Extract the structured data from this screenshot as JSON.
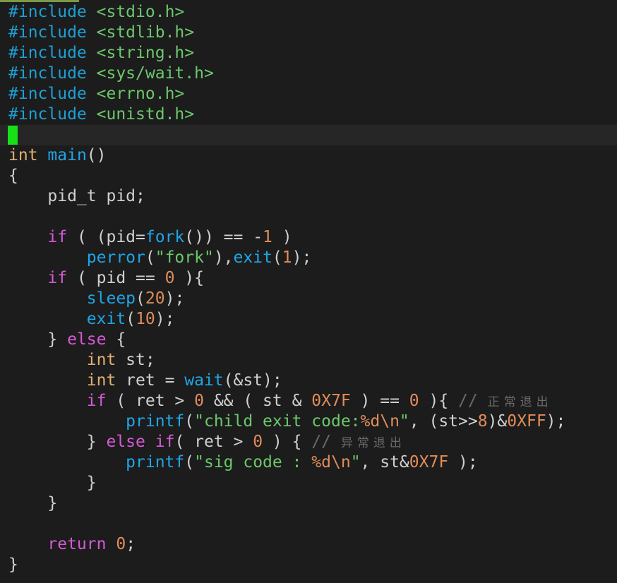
{
  "colors": {
    "background": "#1c1c1c",
    "cursor": "#18e018",
    "preprocessor": "#1e9fd4",
    "header": "#6cc86c",
    "type": "#e0b070",
    "function": "#1ea6e8",
    "keyword": "#d65ad6",
    "number": "#e08c5a",
    "string": "#6cc86c",
    "comment": "#6a6a6a",
    "text": "#d0d0d0"
  },
  "code": {
    "lines": [
      [
        [
          "inc",
          "#include"
        ],
        [
          "plain",
          " "
        ],
        [
          "hdr",
          "<stdio.h>"
        ]
      ],
      [
        [
          "inc",
          "#include"
        ],
        [
          "plain",
          " "
        ],
        [
          "hdr",
          "<stdlib.h>"
        ]
      ],
      [
        [
          "inc",
          "#include"
        ],
        [
          "plain",
          " "
        ],
        [
          "hdr",
          "<string.h>"
        ]
      ],
      [
        [
          "inc",
          "#include"
        ],
        [
          "plain",
          " "
        ],
        [
          "hdr",
          "<sys/wait.h>"
        ]
      ],
      [
        [
          "inc",
          "#include"
        ],
        [
          "plain",
          " "
        ],
        [
          "hdr",
          "<errno.h>"
        ]
      ],
      [
        [
          "inc",
          "#include"
        ],
        [
          "plain",
          " "
        ],
        [
          "hdr",
          "<unistd.h>"
        ]
      ],
      [],
      [
        [
          "type",
          "int"
        ],
        [
          "plain",
          " "
        ],
        [
          "func",
          "main"
        ],
        [
          "plain",
          "()"
        ]
      ],
      [
        [
          "plain",
          "{"
        ]
      ],
      [
        [
          "plain",
          "    pid_t pid;"
        ]
      ],
      [],
      [
        [
          "plain",
          "    "
        ],
        [
          "kw",
          "if"
        ],
        [
          "plain",
          " ( (pid="
        ],
        [
          "func",
          "fork"
        ],
        [
          "plain",
          "()) == -"
        ],
        [
          "num",
          "1"
        ],
        [
          "plain",
          " )"
        ]
      ],
      [
        [
          "plain",
          "        "
        ],
        [
          "func",
          "perror"
        ],
        [
          "plain",
          "("
        ],
        [
          "str",
          "\"fork\""
        ],
        [
          "plain",
          "),"
        ],
        [
          "func",
          "exit"
        ],
        [
          "plain",
          "("
        ],
        [
          "num",
          "1"
        ],
        [
          "plain",
          ");"
        ]
      ],
      [
        [
          "plain",
          "    "
        ],
        [
          "kw",
          "if"
        ],
        [
          "plain",
          " ( pid == "
        ],
        [
          "num",
          "0"
        ],
        [
          "plain",
          " ){"
        ]
      ],
      [
        [
          "plain",
          "        "
        ],
        [
          "func",
          "sleep"
        ],
        [
          "plain",
          "("
        ],
        [
          "num",
          "20"
        ],
        [
          "plain",
          ");"
        ]
      ],
      [
        [
          "plain",
          "        "
        ],
        [
          "func",
          "exit"
        ],
        [
          "plain",
          "("
        ],
        [
          "num",
          "10"
        ],
        [
          "plain",
          ");"
        ]
      ],
      [
        [
          "plain",
          "    } "
        ],
        [
          "kw",
          "else"
        ],
        [
          "plain",
          " {"
        ]
      ],
      [
        [
          "plain",
          "        "
        ],
        [
          "type",
          "int"
        ],
        [
          "plain",
          " st;"
        ]
      ],
      [
        [
          "plain",
          "        "
        ],
        [
          "type",
          "int"
        ],
        [
          "plain",
          " ret = "
        ],
        [
          "func",
          "wait"
        ],
        [
          "plain",
          "(&st);"
        ]
      ],
      [
        [
          "plain",
          "        "
        ],
        [
          "kw",
          "if"
        ],
        [
          "plain",
          " ( ret > "
        ],
        [
          "num",
          "0"
        ],
        [
          "plain",
          " && ( st & "
        ],
        [
          "num",
          "0X7F"
        ],
        [
          "plain",
          " ) == "
        ],
        [
          "num",
          "0"
        ],
        [
          "plain",
          " ){ "
        ],
        [
          "cmt",
          "// "
        ],
        [
          "cmtcjk",
          "正常退出"
        ]
      ],
      [
        [
          "plain",
          "            "
        ],
        [
          "func",
          "printf"
        ],
        [
          "plain",
          "("
        ],
        [
          "str",
          "\"child exit code:"
        ],
        [
          "fmt",
          "%d\\n"
        ],
        [
          "str",
          "\""
        ],
        [
          "plain",
          ", (st>>"
        ],
        [
          "num",
          "8"
        ],
        [
          "plain",
          ")&"
        ],
        [
          "num",
          "0XFF"
        ],
        [
          "plain",
          ");"
        ]
      ],
      [
        [
          "plain",
          "        } "
        ],
        [
          "kw",
          "else"
        ],
        [
          "plain",
          " "
        ],
        [
          "kw",
          "if"
        ],
        [
          "plain",
          "( ret > "
        ],
        [
          "num",
          "0"
        ],
        [
          "plain",
          " ) { "
        ],
        [
          "cmt",
          "// "
        ],
        [
          "cmtcjk",
          "异常退出"
        ]
      ],
      [
        [
          "plain",
          "            "
        ],
        [
          "func",
          "printf"
        ],
        [
          "plain",
          "("
        ],
        [
          "str",
          "\"sig code : "
        ],
        [
          "fmt",
          "%d\\n"
        ],
        [
          "str",
          "\""
        ],
        [
          "plain",
          ", st&"
        ],
        [
          "num",
          "0X7F"
        ],
        [
          "plain",
          " );"
        ]
      ],
      [
        [
          "plain",
          "        }"
        ]
      ],
      [
        [
          "plain",
          "    }"
        ]
      ],
      [],
      [
        [
          "plain",
          "    "
        ],
        [
          "kw",
          "return"
        ],
        [
          "plain",
          " "
        ],
        [
          "num",
          "0"
        ],
        [
          "plain",
          ";"
        ]
      ],
      [
        [
          "plain",
          "}"
        ]
      ]
    ],
    "current_line_index": 6
  }
}
